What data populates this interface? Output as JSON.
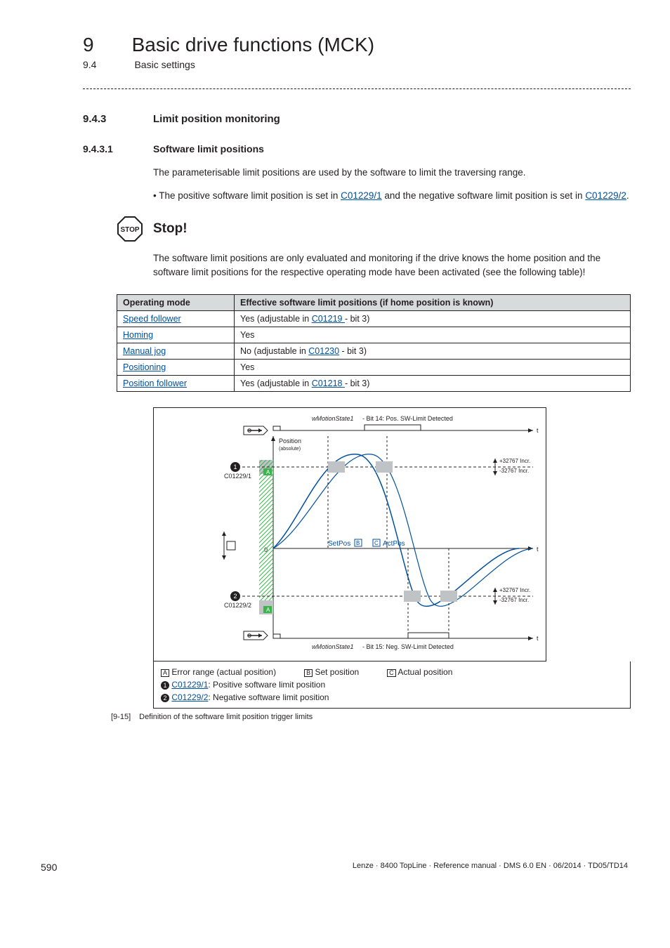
{
  "header": {
    "chapter_number": "9",
    "chapter_title": "Basic drive functions (MCK)",
    "section_number": "9.4",
    "section_title": "Basic settings"
  },
  "h1": {
    "num": "9.4.3",
    "text": "Limit position monitoring"
  },
  "h2": {
    "num": "9.4.3.1",
    "text": "Software limit positions"
  },
  "body": {
    "intro": "The parameterisable limit positions are used by the software to limit the traversing range.",
    "bullet_pre": "The positive software limit position is set in ",
    "bullet_link1": "C01229/1",
    "bullet_mid": " and the negative software limit position is set in ",
    "bullet_link2": "C01229/2",
    "bullet_end": "."
  },
  "stop": {
    "label": "Stop!",
    "text": "The software limit positions are only evaluated and monitoring if the drive knows the home position and the software limit positions for the respective operating mode have been activated (see the following table)!"
  },
  "table": {
    "headers": [
      "Operating mode",
      "Effective software limit positions (if home position is known)"
    ],
    "rows": [
      {
        "mode": "Speed follower",
        "mode_link": true,
        "eff_pre": "Yes (adjustable in ",
        "eff_link": "C01219 ",
        "eff_post": " - bit 3)"
      },
      {
        "mode": "Homing",
        "mode_link": true,
        "eff_plain": "Yes"
      },
      {
        "mode": "Manual jog",
        "mode_link": true,
        "eff_pre": "No (adjustable in ",
        "eff_link": "C01230",
        "eff_post": " - bit 3)"
      },
      {
        "mode": "Positioning",
        "mode_link": true,
        "eff_plain": "Yes"
      },
      {
        "mode": "Position follower",
        "mode_link": true,
        "eff_pre": "Yes (adjustable in ",
        "eff_link": "C01218 ",
        "eff_post": " - bit 3)"
      }
    ]
  },
  "chart_data": {
    "type": "line",
    "title": "",
    "xlabel": "t",
    "ylabel": "Position (absolute)",
    "ylim": [
      -60,
      140
    ],
    "limits": {
      "positive": {
        "param": "C01229/1",
        "value": 100,
        "tolerance_upper": "+32767 Incr.",
        "tolerance_lower": "-32767 Incr."
      },
      "negative": {
        "param": "C01229/2",
        "value": -40,
        "tolerance_upper": "+32767 Incr.",
        "tolerance_lower": "-32767 Incr."
      }
    },
    "series": [
      {
        "name": "SetPos",
        "letter": "B",
        "color": "#0050a0",
        "x": [
          0,
          40,
          80,
          140,
          200,
          260,
          320,
          400,
          480
        ],
        "values": [
          0,
          40,
          90,
          120,
          85,
          10,
          -55,
          -20,
          0
        ]
      },
      {
        "name": "ActPos",
        "letter": "C",
        "color": "#0050a0",
        "x": [
          0,
          60,
          100,
          160,
          220,
          280,
          340,
          420,
          500
        ],
        "values": [
          0,
          40,
          90,
          120,
          85,
          10,
          -55,
          -20,
          0
        ]
      }
    ],
    "status_bits": [
      {
        "label": "wMotionState1 - Bit 14: Pos. SW-Limit Detected",
        "active_ranges_x": [
          [
            140,
            260
          ]
        ]
      },
      {
        "label": "wMotionState1 - Bit 15: Neg. SW-Limit Detected",
        "active_ranges_x": [
          [
            300,
            420
          ]
        ]
      }
    ],
    "annotations": [
      {
        "kind": "error_range_actual_position",
        "letter": "A"
      },
      {
        "kind": "positive_limit_marker",
        "circle": 1
      },
      {
        "kind": "negative_limit_marker",
        "circle": 2
      }
    ]
  },
  "legend": {
    "a": "Error range (actual position)",
    "b": "Set position",
    "c": "Actual position",
    "one_link": "C01229/1",
    "one_text": ": Positive software limit position",
    "two_link": "C01229/2",
    "two_text": ": Negative software limit position"
  },
  "caption": {
    "num": "[9-15]",
    "text": "Definition of the software limit position trigger limits"
  },
  "footer": {
    "page": "590",
    "right": "Lenze · 8400 TopLine · Reference manual · DMS 6.0 EN · 06/2014 · TD05/TD14"
  }
}
